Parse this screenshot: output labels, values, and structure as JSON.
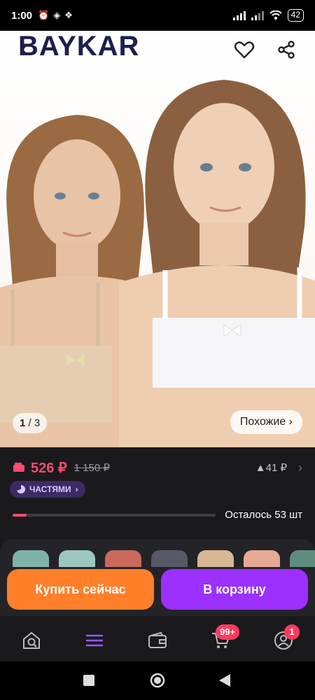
{
  "status": {
    "time": "1:00",
    "battery": "42"
  },
  "hero": {
    "brand": "BAYKAR",
    "counter_current": "1",
    "counter_total": "3",
    "similar_label": "Похожие"
  },
  "pricing": {
    "price": "526 ₽",
    "old_price": "1 150 ₽",
    "delta": "▲41 ₽",
    "installments_label": "ЧАСТЯМИ",
    "stock_label": "Осталось 53 шт",
    "stock_progress": 0.07
  },
  "actions": {
    "buy_label": "Купить сейчас",
    "cart_label": "В корзину"
  },
  "nav": {
    "cart_badge": "99+",
    "profile_badge": "1"
  },
  "colors": {
    "accent_price": "#ff4b6e",
    "buy": "#ff7f2a",
    "cart": "#9b30ff",
    "nav_active": "#9b59ff"
  }
}
